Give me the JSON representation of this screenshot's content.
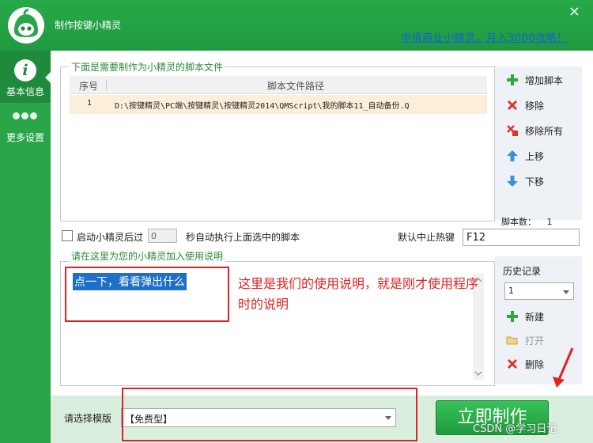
{
  "window": {
    "title": "制作按键小精灵",
    "close_glyph": "×",
    "promo_link": "申请商业小精灵，月入3000攻略！"
  },
  "sidebar": {
    "items": [
      {
        "label": "基本信息",
        "icon": "info-icon",
        "active": true
      },
      {
        "label": "更多设置",
        "icon": "more-dots-icon",
        "active": false
      }
    ]
  },
  "scripts": {
    "legend": "下面是需要制作为小精灵的脚本文件",
    "columns": [
      "序号",
      "脚本文件路径"
    ],
    "rows": [
      {
        "index": "1",
        "path": "D:\\按键精灵\\PC端\\按键精灵\\按键精灵2014\\QMScript\\我的脚本11_自动备份.Q"
      }
    ],
    "actions": [
      {
        "label": "增加脚本",
        "icon": "plus-icon"
      },
      {
        "label": "移除",
        "icon": "x-icon"
      },
      {
        "label": "移除所有",
        "icon": "remove-all-icon"
      },
      {
        "label": "上移",
        "icon": "arrow-up-icon"
      },
      {
        "label": "下移",
        "icon": "arrow-down-icon"
      }
    ],
    "count_label": "脚本数：",
    "count_value": "1"
  },
  "options": {
    "autorun_prefix": "启动小精灵后过",
    "autorun_seconds": "0",
    "autorun_suffix": "秒自动执行上面选中的脚本",
    "autorun_checked": false,
    "hotkey_label": "默认中止热键",
    "hotkey_value": "F12"
  },
  "description": {
    "legend": "请在这里为您的小精灵加入使用说明",
    "text": "点一下，看看弹出什么",
    "annotation": "这里是我们的使用说明，就是刚才使用程序时的说明",
    "history_label": "历史记录",
    "history_value": "1",
    "actions": [
      {
        "label": "新建",
        "icon": "plus-icon",
        "enabled": true
      },
      {
        "label": "打开",
        "icon": "folder-icon",
        "enabled": false
      },
      {
        "label": "删除",
        "icon": "x-icon",
        "enabled": true
      }
    ]
  },
  "footer": {
    "template_label": "请选择模版",
    "template_value": "【免费型】",
    "make_button": "立即制作",
    "watermark": "CSDN @学习日记"
  },
  "colors": {
    "brand_green": "#27a94a",
    "annotation_red": "#e02222",
    "link_blue": "#1a5fd6",
    "selection_blue": "#1d6fc9"
  }
}
